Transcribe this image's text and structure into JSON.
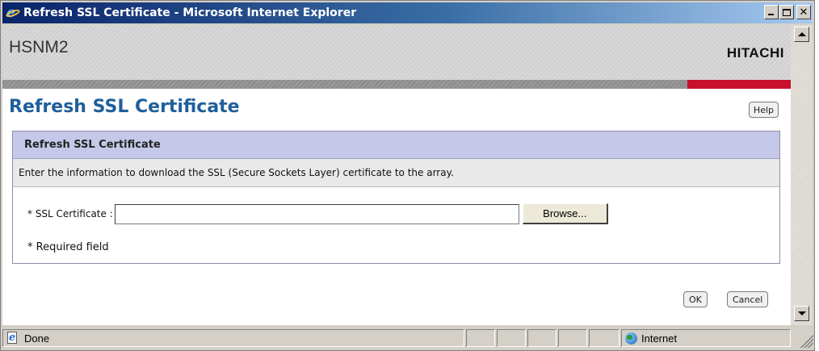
{
  "window": {
    "title": "Refresh SSL Certificate - Microsoft Internet Explorer",
    "minimize_icon": "minimize-icon",
    "maximize_icon": "maximize-icon",
    "close_icon": "close-icon",
    "close_glyph": "✕"
  },
  "header": {
    "app_name": "HSNM2",
    "brand": "HITACHI",
    "accent_color": "#c8102e"
  },
  "page": {
    "title": "Refresh SSL Certificate",
    "help_label": "Help"
  },
  "panel": {
    "title": "Refresh SSL Certificate",
    "description": "Enter the information to download the SSL (Secure Sockets Layer) certificate to the array.",
    "field_label": "* SSL Certificate :",
    "field_value": "",
    "browse_label": "Browse...",
    "required_note": "* Required field"
  },
  "actions": {
    "ok_label": "OK",
    "cancel_label": "Cancel"
  },
  "statusbar": {
    "status_text": "Done",
    "zone_text": "Internet"
  }
}
